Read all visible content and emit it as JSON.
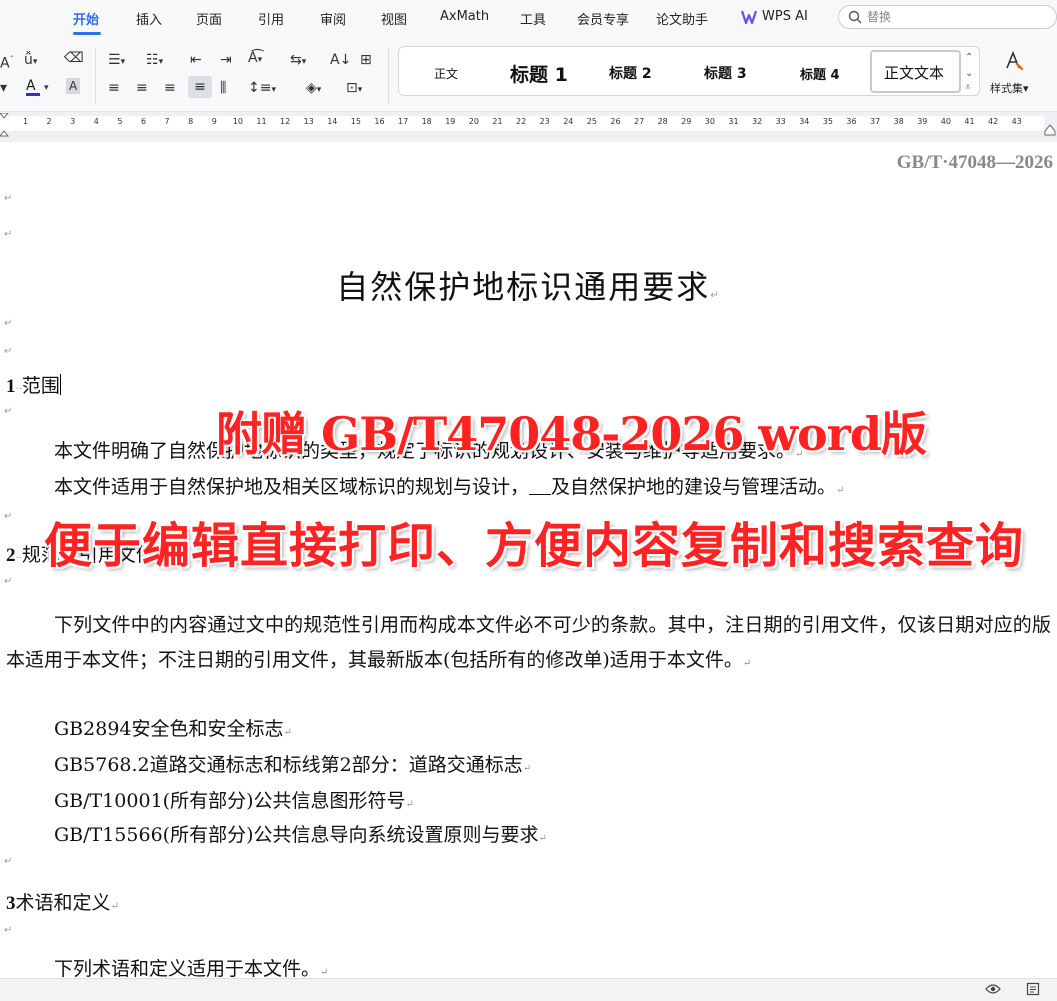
{
  "menu": {
    "tabs": [
      "开始",
      "插入",
      "页面",
      "引用",
      "审阅",
      "视图",
      "AxMath",
      "工具",
      "会员专享",
      "论文助手",
      "WPS AI"
    ],
    "active": "开始"
  },
  "search": {
    "placeholder": "替换"
  },
  "toolbar": {
    "styles": [
      "正文",
      "标题 1",
      "标题 2",
      "标题 3",
      "标题 4",
      "正文文本"
    ],
    "styles_label": "样式集",
    "accent": "#2f6fe6"
  },
  "ruler": {
    "numbers": [
      "1",
      "2",
      "3",
      "4",
      "5",
      "6",
      "7",
      "8",
      "9",
      "10",
      "11",
      "12",
      "13",
      "14",
      "15",
      "16",
      "17",
      "18",
      "19",
      "20",
      "21",
      "22",
      "23",
      "24",
      "25",
      "26",
      "27",
      "28",
      "29",
      "30",
      "31",
      "32",
      "33",
      "34",
      "35",
      "36",
      "37",
      "38",
      "39",
      "40",
      "41",
      "42",
      "43"
    ]
  },
  "document": {
    "header_code": "GB/T·47048—2026",
    "title": "自然保护地标识通用要求",
    "section1": {
      "num": "1",
      "title": "范围",
      "p1": "本文件明确了自然保护地标识的类型，规定了标识的规划设计、安装与维护等适用要求。",
      "p2a": "本文件适用于自然保护地及相关区域标识的规划与设计，",
      "p2b": "及自然保护地的建设与管理活动。"
    },
    "section2": {
      "num": "2",
      "title": "规范性引用文件",
      "p1": "下列文件中的内容通过文中的规范性引用而构成本文件必不可少的条款。其中，注日期的引用文件，仅该日期对应的版本适用于本文件；不注日期的引用文件，其最新版本(包括所有的修改单)适用于本文件。",
      "refs": [
        "GB2894安全色和安全标志",
        "GB5768.2道路交通标志和标线第2部分：道路交通标志",
        "GB/T10001(所有部分)公共信息图形符号",
        "GB/T15566(所有部分)公共信息导向系统设置原则与要求"
      ]
    },
    "section3": {
      "num": "3",
      "title": "术语和定义",
      "p1": "下列术语和定义适用于本文件。"
    }
  },
  "overlay": {
    "line1": "附赠 GB/T47048-2026 word版",
    "line2": "便于编辑直接打印、方便内容复制和搜索查询",
    "color": "#ff2222"
  }
}
